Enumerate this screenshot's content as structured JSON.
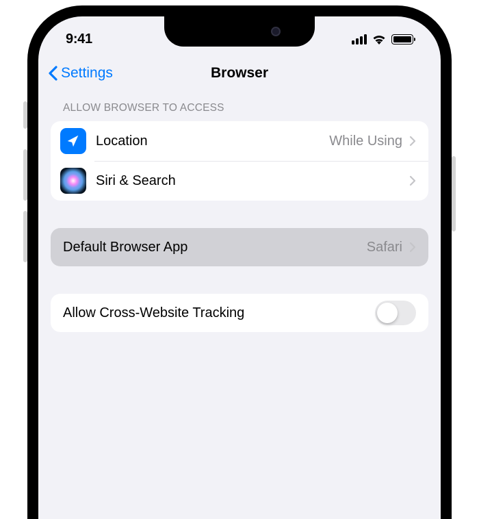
{
  "status": {
    "time": "9:41"
  },
  "nav": {
    "back_label": "Settings",
    "title": "Browser"
  },
  "section1": {
    "header": "ALLOW BROWSER TO ACCESS",
    "location": {
      "label": "Location",
      "value": "While Using"
    },
    "siri": {
      "label": "Siri & Search"
    }
  },
  "section2": {
    "default_browser": {
      "label": "Default Browser App",
      "value": "Safari"
    }
  },
  "section3": {
    "tracking": {
      "label": "Allow Cross-Website Tracking"
    }
  }
}
